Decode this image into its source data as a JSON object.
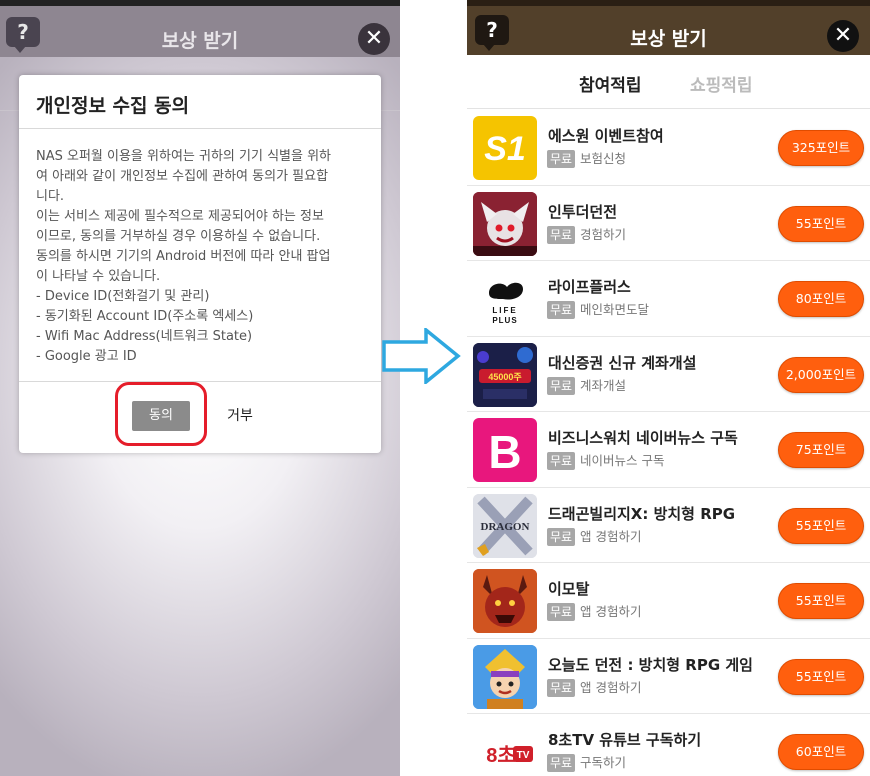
{
  "left_screen": {
    "header": {
      "help_label": "?",
      "title": "보상 받기",
      "close_label": "✕"
    },
    "dialog": {
      "title": "개인정보 수집 동의",
      "body_lines": [
        "NAS 오퍼월 이용을 위하여는 귀하의 기기 식별을 위하",
        "여 아래와 같이 개인정보 수집에 관하여 동의가 필요합",
        "니다.",
        "이는 서비스 제공에 필수적으로 제공되어야 하는 정보",
        "이므로, 동의를 거부하실 경우 이용하실 수 없습니다.",
        "동의를 하시면 기기의 Android 버전에 따라 안내 팝업",
        "이 나타날 수 있습니다.",
        "- Device ID(전화걸기 및 관리)",
        "- 동기화된 Account ID(주소록 엑세스)",
        "- Wifi Mac Address(네트워크 State)",
        "- Google 광고 ID"
      ],
      "agree_label": "동의",
      "refuse_label": "거부"
    }
  },
  "right_screen": {
    "header": {
      "help_label": "?",
      "title": "보상 받기",
      "close_label": "✕"
    },
    "tabs": [
      {
        "label": "참여적립",
        "active": true
      },
      {
        "label": "쇼핑적립",
        "active": false
      }
    ],
    "offers": [
      {
        "name": "에스원 이벤트참여",
        "badge": "무료",
        "sub": "보험신청",
        "points": "325포인트",
        "icon": "s1-logo-icon",
        "icon_text": "S1"
      },
      {
        "name": "인투더던전",
        "badge": "무료",
        "sub": "경험하기",
        "points": "55포인트",
        "icon": "dungeon-character-icon",
        "icon_text": ""
      },
      {
        "name": "라이프플러스",
        "badge": "무료",
        "sub": "메인화면도달",
        "points": "80포인트",
        "icon": "life-plus-logo-icon",
        "icon_text": "LIFE PLUS"
      },
      {
        "name": "대신증권 신규 계좌개설",
        "badge": "무료",
        "sub": "계좌개설",
        "points": "2,000포인트",
        "icon": "daishin-promo-icon",
        "icon_text": "45000주"
      },
      {
        "name": "비즈니스워치 네이버뉴스 구독",
        "badge": "무료",
        "sub": "네이버뉴스 구독",
        "points": "75포인트",
        "icon": "b-logo-icon",
        "icon_text": "B"
      },
      {
        "name": "드래곤빌리지X: 방치형 RPG",
        "badge": "무료",
        "sub": "앱 경험하기",
        "points": "55포인트",
        "icon": "dragon-village-icon",
        "icon_text": "DRAGON"
      },
      {
        "name": "이모탈",
        "badge": "무료",
        "sub": "앱 경험하기",
        "points": "55포인트",
        "icon": "immortal-demon-icon",
        "icon_text": ""
      },
      {
        "name": "오늘도 던전 : 방치형 RPG 게임",
        "badge": "무료",
        "sub": "앱 경험하기",
        "points": "55포인트",
        "icon": "hero-character-icon",
        "icon_text": ""
      },
      {
        "name": "8초TV 유튜브 구독하기",
        "badge": "무료",
        "sub": "구독하기",
        "points": "60포인트",
        "icon": "8chotv-logo-icon",
        "icon_text": "8초TV"
      }
    ]
  },
  "colors": {
    "accent_orange": "#ff5f0e",
    "right_header_brown": "#52402a",
    "left_header_gray": "#8e8691",
    "highlight_red": "#e51d2a",
    "arrow_blue": "#2ea8e0"
  }
}
